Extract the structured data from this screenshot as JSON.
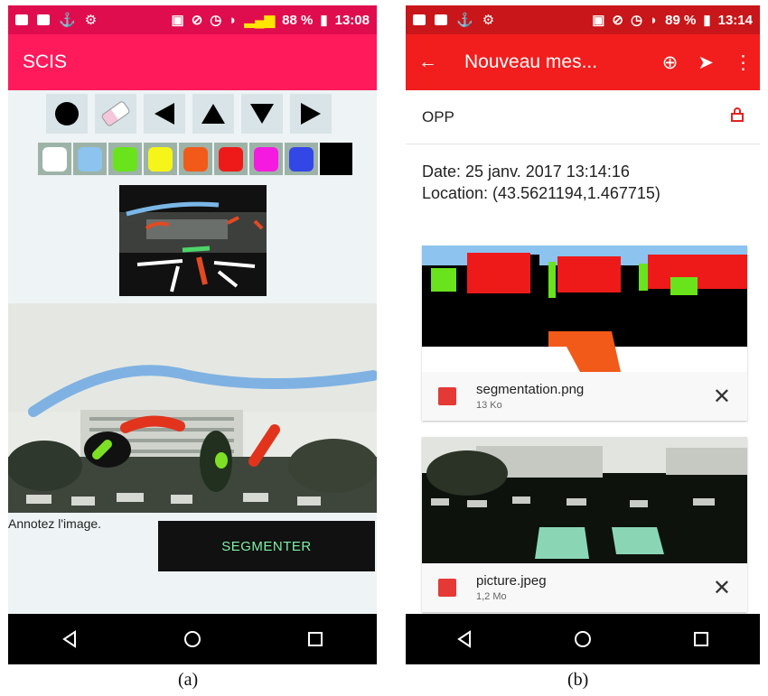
{
  "phone_a": {
    "status": {
      "battery": "88 %",
      "time": "13:08"
    },
    "app_title": "SCIS",
    "tools": [
      "brush-dot",
      "eraser",
      "arrow-left",
      "arrow-up",
      "arrow-down",
      "arrow-right"
    ],
    "colors": [
      "#ffffff",
      "#8cc3ef",
      "#69e31c",
      "#f5f51a",
      "#f25a1a",
      "#ee1a1a",
      "#f51ae0",
      "#3347e6",
      "#000000"
    ],
    "hint": "Annotez l'image.",
    "segment_button": "SEGMENTER"
  },
  "phone_b": {
    "status": {
      "battery": "89 %",
      "time": "13:14"
    },
    "title": "Nouveau mes...",
    "recipient": "OPP",
    "date_line": "Date: 25 janv. 2017 13:14:16",
    "location_line": "Location: (43.5621194,1.467715)",
    "attachments": [
      {
        "name": "segmentation.png",
        "size": "13 Ko"
      },
      {
        "name": "picture.jpeg",
        "size": "1,2 Mo"
      }
    ]
  },
  "captions": {
    "a": "(a)",
    "b": "(b)"
  }
}
